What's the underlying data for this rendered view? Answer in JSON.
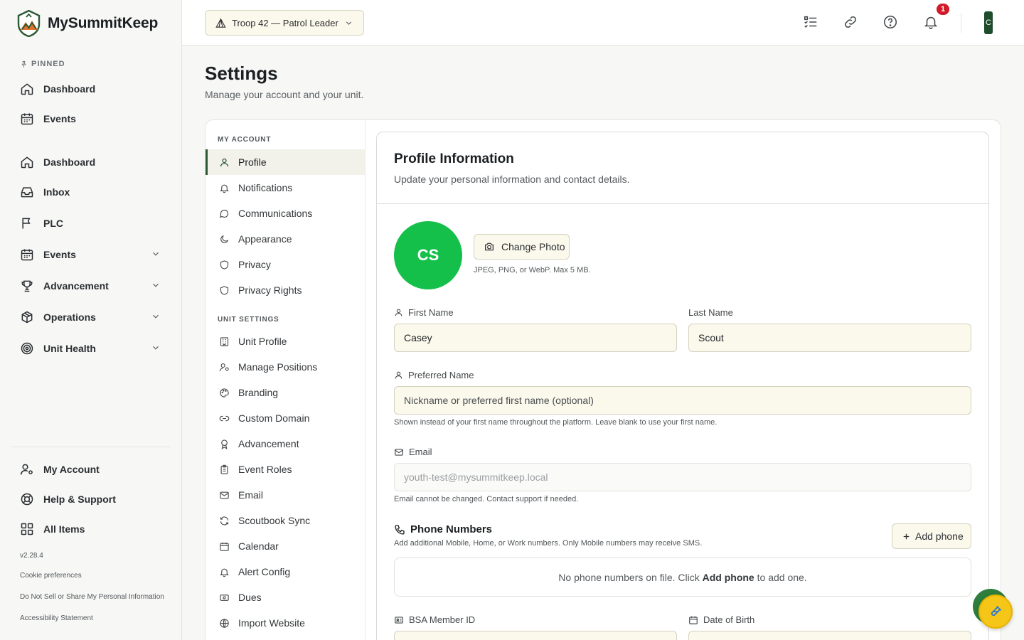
{
  "brand": {
    "name": "MySummitKeep"
  },
  "sidebar": {
    "pinned_label": "PINNED",
    "pinned": [
      {
        "label": "Dashboard",
        "icon": "home-icon"
      },
      {
        "label": "Events",
        "icon": "calendar-icon"
      }
    ],
    "items": [
      {
        "label": "Dashboard",
        "icon": "home-icon"
      },
      {
        "label": "Inbox",
        "icon": "inbox-icon"
      },
      {
        "label": "PLC",
        "icon": "flag-icon"
      },
      {
        "label": "Events",
        "icon": "calendar-icon",
        "expandable": true
      },
      {
        "label": "Advancement",
        "icon": "trophy-icon",
        "expandable": true
      },
      {
        "label": "Operations",
        "icon": "box-icon",
        "expandable": true
      },
      {
        "label": "Unit Health",
        "icon": "target-icon",
        "expandable": true
      }
    ],
    "bottom": [
      {
        "label": "My Account",
        "icon": "user-gear-icon"
      },
      {
        "label": "Help & Support",
        "icon": "lifebuoy-icon"
      },
      {
        "label": "All Items",
        "icon": "grid-icon"
      }
    ],
    "version": "v2.28.4",
    "links": [
      "Cookie preferences",
      "Do Not Sell or Share My Personal Information",
      "Accessibility Statement"
    ]
  },
  "topbar": {
    "unit_selector": "Troop 42 — Patrol Leader",
    "notification_count": "1",
    "avatar_initial": "C"
  },
  "page": {
    "title": "Settings",
    "subtitle": "Manage your account and your unit."
  },
  "settings_nav": {
    "my_account_label": "MY ACCOUNT",
    "my_account": [
      {
        "label": "Profile",
        "icon": "user-icon",
        "active": true
      },
      {
        "label": "Notifications",
        "icon": "bell-icon"
      },
      {
        "label": "Communications",
        "icon": "chat-bubble-icon"
      },
      {
        "label": "Appearance",
        "icon": "moon-icon"
      },
      {
        "label": "Privacy",
        "icon": "shield-icon"
      },
      {
        "label": "Privacy Rights",
        "icon": "shield-icon"
      }
    ],
    "unit_settings_label": "UNIT SETTINGS",
    "unit_settings": [
      {
        "label": "Unit Profile",
        "icon": "building-icon"
      },
      {
        "label": "Manage Positions",
        "icon": "user-key-icon"
      },
      {
        "label": "Branding",
        "icon": "palette-icon"
      },
      {
        "label": "Custom Domain",
        "icon": "link-icon"
      },
      {
        "label": "Advancement",
        "icon": "award-icon"
      },
      {
        "label": "Event Roles",
        "icon": "clipboard-icon"
      },
      {
        "label": "Email",
        "icon": "mail-icon"
      },
      {
        "label": "Scoutbook Sync",
        "icon": "refresh-icon"
      },
      {
        "label": "Calendar",
        "icon": "calendar-icon"
      },
      {
        "label": "Alert Config",
        "icon": "bell-icon"
      },
      {
        "label": "Dues",
        "icon": "money-icon"
      },
      {
        "label": "Import Website",
        "icon": "globe-icon"
      }
    ]
  },
  "profile": {
    "title": "Profile Information",
    "subtitle": "Update your personal information and contact details.",
    "avatar_initials": "CS",
    "avatar_color": "#15c04a",
    "change_photo": "Change Photo",
    "photo_hint": "JPEG, PNG, or WebP. Max 5 MB.",
    "first_name_label": "First Name",
    "first_name": "Casey",
    "last_name_label": "Last Name",
    "last_name": "Scout",
    "preferred_name_label": "Preferred Name",
    "preferred_name_placeholder": "Nickname or preferred first name (optional)",
    "preferred_name_help": "Shown instead of your first name throughout the platform. Leave blank to use your first name.",
    "email_label": "Email",
    "email": "youth-test@mysummitkeep.local",
    "email_help": "Email cannot be changed. Contact support if needed.",
    "phone_title": "Phone Numbers",
    "phone_sub": "Add additional Mobile, Home, or Work numbers. Only Mobile numbers may receive SMS.",
    "add_phone": "Add phone",
    "phone_empty_pre": "No phone numbers on file. Click",
    "phone_empty_bold": "Add phone",
    "phone_empty_post": "to add one.",
    "bsa_label": "BSA Member ID",
    "dob_label": "Date of Birth"
  },
  "colors": {
    "brand_green": "#2c5a37",
    "accent_yellow": "#f5c518",
    "badge_red": "#d11a2a",
    "input_bg": "#fbf8ec"
  }
}
